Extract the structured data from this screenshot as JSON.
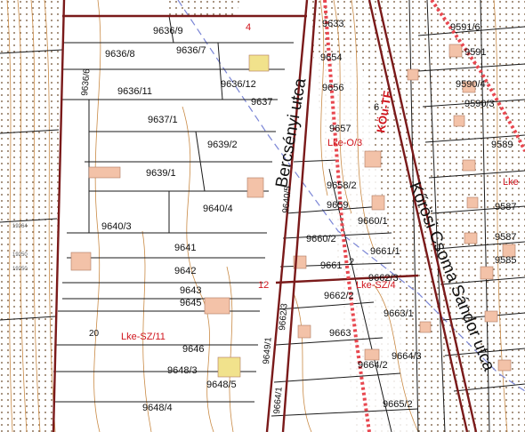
{
  "map": {
    "colors": {
      "background": "#ffffff",
      "hatch": "#6b4a2a",
      "contour": "#c98a45",
      "parcel_line": "#1a1a1a",
      "zone_border": "#7a1a1a",
      "zone_text": "#d0141c",
      "dashed_line": "#7b86d6",
      "building_fill": "#f3c2a8",
      "building_yellow": "#f1e28c"
    },
    "street_labels": {
      "bercsenyi": "Bercsényi utca",
      "korosi": "Kőrösi Csoma Sándor utca"
    },
    "zone_labels": {
      "kou_tf": "KÖu-TF",
      "lke_o3": "Lke-O/3",
      "lke_sz11": "Lke-SZ/11",
      "lke_sz4": "Lke-SZ/4",
      "lke_edge": "Lke",
      "marker_12": "12",
      "marker_4": "4"
    },
    "parcel_labels": {
      "p9636_9": "9636/9",
      "p9636_8": "9636/8",
      "p9636_7": "9636/7",
      "p9636_6": "9636/6",
      "p9636_11": "9636/11",
      "p9636_12": "9636/12",
      "p9637_1": "9637/1",
      "p9637": "9637",
      "p9639_2": "9639/2",
      "p9639_1": "9639/1",
      "p9640_4": "9640/4",
      "p9640_3": "9640/3",
      "p9640_5": "9640/5",
      "p9641": "9641",
      "p9642": "9642",
      "p9643": "9643",
      "p9645": "9645",
      "p9646": "9646",
      "p9648_3": "9648/3",
      "p9648_5": "9648/5",
      "p9648_4": "9648/4",
      "p9649_1": "9649/1",
      "p9662_3": "9662/3",
      "p9664_1": "9664/1",
      "p9633": "9633",
      "p9654": "9654",
      "p9656": "9656",
      "p9657": "9657",
      "p9658_2": "9658/2",
      "p9659": "9659",
      "p9660_1": "9660/1",
      "p9660_2": "9660/2",
      "p9661_1": "9661/1",
      "p9661": "9661",
      "p9662_3b": "9662/3",
      "p9662_2": "9662/2",
      "p9663_1": "9663/1",
      "p9663": "9663",
      "p9664_2": "9664/2",
      "p9664_3": "9664/3",
      "p9665_2": "9665/2",
      "p9591_6": "9591/6",
      "p9591": "9591",
      "p9590_4": "9590/4",
      "p9590_3": "9590/3",
      "p9589": "9589",
      "p9587": "9587",
      "p9587b": "9587",
      "p9585": "9585",
      "p6": "6",
      "p2": "2",
      "p20": "20"
    },
    "elevation_marks": [
      "19264",
      "19250",
      "19250"
    ]
  }
}
